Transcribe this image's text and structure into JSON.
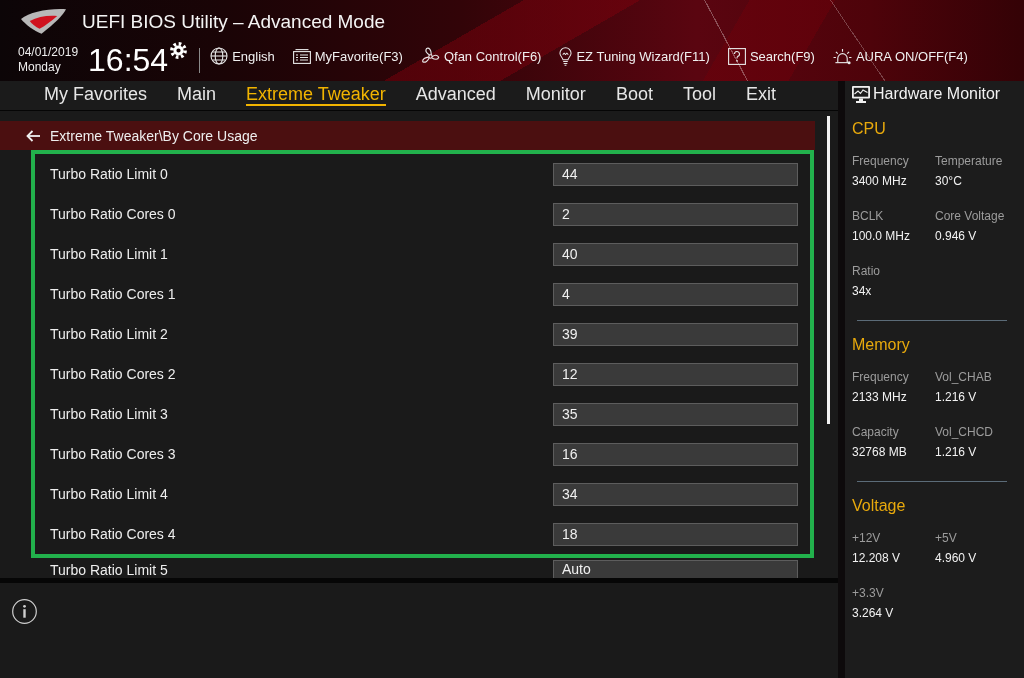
{
  "header": {
    "title": "UEFI BIOS Utility – Advanced Mode",
    "date": "04/01/2019",
    "day": "Monday",
    "time": "16:54",
    "tools": [
      {
        "kind": "language",
        "label": "English"
      },
      {
        "kind": "favorites",
        "label": "MyFavorite(F3)"
      },
      {
        "kind": "fan",
        "label": "Qfan Control(F6)"
      },
      {
        "kind": "wizard",
        "label": "EZ Tuning Wizard(F11)"
      },
      {
        "kind": "search",
        "label": "Search(F9)"
      },
      {
        "kind": "lighting",
        "label": "AURA ON/OFF(F4)"
      }
    ]
  },
  "tabs": [
    {
      "label": "My Favorites",
      "selected": false
    },
    {
      "label": "Main",
      "selected": false
    },
    {
      "label": "Extreme Tweaker",
      "selected": true
    },
    {
      "label": "Advanced",
      "selected": false
    },
    {
      "label": "Monitor",
      "selected": false
    },
    {
      "label": "Boot",
      "selected": false
    },
    {
      "label": "Tool",
      "selected": false
    },
    {
      "label": "Exit",
      "selected": false
    }
  ],
  "breadcrumb": "Extreme Tweaker\\By Core Usage",
  "settings": {
    "highlighted_rows": [
      {
        "label": "Turbo Ratio Limit 0",
        "value": "44"
      },
      {
        "label": "Turbo Ratio Cores 0",
        "value": "2"
      },
      {
        "label": "Turbo Ratio Limit 1",
        "value": "40"
      },
      {
        "label": "Turbo Ratio Cores 1",
        "value": "4"
      },
      {
        "label": "Turbo Ratio Limit 2",
        "value": "39"
      },
      {
        "label": "Turbo Ratio Cores 2",
        "value": "12"
      },
      {
        "label": "Turbo Ratio Limit 3",
        "value": "35"
      },
      {
        "label": "Turbo Ratio Cores 3",
        "value": "16"
      },
      {
        "label": "Turbo Ratio Limit 4",
        "value": "34"
      },
      {
        "label": "Turbo Ratio Cores 4",
        "value": "18"
      }
    ],
    "other_rows": [
      {
        "label": "Turbo Ratio Limit 5",
        "value": "Auto"
      }
    ]
  },
  "hardware_monitor": {
    "title": "Hardware Monitor",
    "sections": [
      {
        "title": "CPU",
        "items": [
          {
            "label": "Frequency",
            "value": "3400 MHz"
          },
          {
            "label": "Temperature",
            "value": "30°C"
          },
          {
            "label": "BCLK",
            "value": "100.0 MHz"
          },
          {
            "label": "Core Voltage",
            "value": "0.946 V"
          },
          {
            "label": "Ratio",
            "value": "34x"
          }
        ]
      },
      {
        "title": "Memory",
        "items": [
          {
            "label": "Frequency",
            "value": "2133 MHz"
          },
          {
            "label": "Vol_CHAB",
            "value": "1.216 V"
          },
          {
            "label": "Capacity",
            "value": "32768 MB"
          },
          {
            "label": "Vol_CHCD",
            "value": "1.216 V"
          }
        ]
      },
      {
        "title": "Voltage",
        "items": [
          {
            "label": "+12V",
            "value": "12.208 V"
          },
          {
            "label": "+5V",
            "value": "4.960 V"
          },
          {
            "label": "+3.3V",
            "value": "3.264 V"
          }
        ]
      }
    ]
  }
}
